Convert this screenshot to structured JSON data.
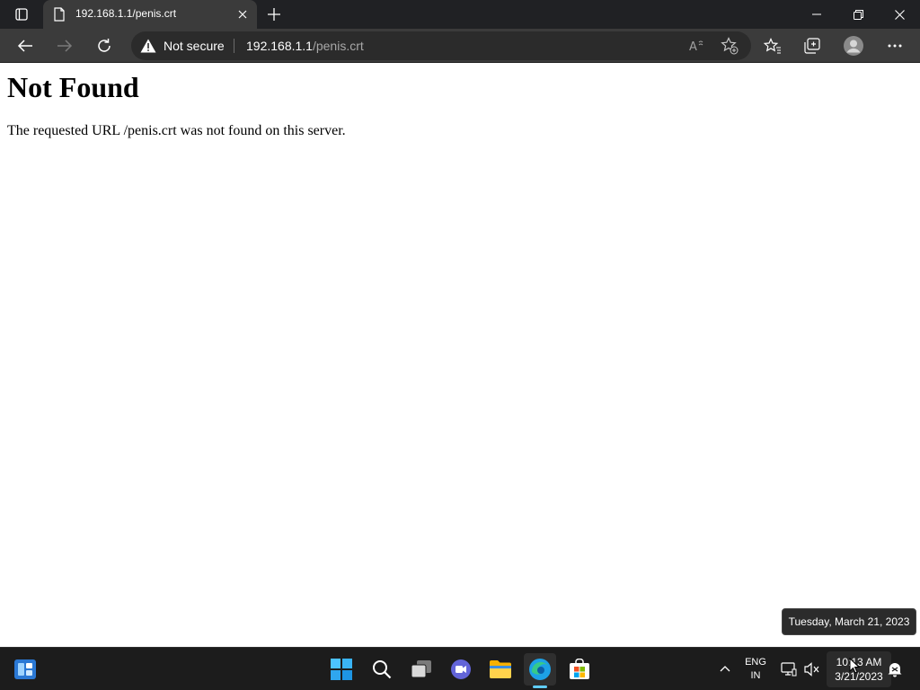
{
  "browser": {
    "tab": {
      "title": "192.168.1.1/penis.crt"
    },
    "address_bar": {
      "security_label": "Not secure",
      "url_host": "192.168.1.1",
      "url_path": "/penis.crt"
    },
    "icons": {
      "tab_actions": "tab-actions-icon",
      "favicon": "page-icon",
      "tab_close": "close-icon",
      "new_tab": "plus-icon",
      "minimize": "minimize-icon",
      "restore": "restore-icon",
      "close_window": "close-icon",
      "back": "arrow-left-icon",
      "forward": "arrow-right-icon",
      "refresh": "refresh-icon",
      "warning": "warning-icon",
      "read_aloud": "read-aloud-icon",
      "add_favorite": "star-plus-icon",
      "favorites": "favorites-icon",
      "collections": "collections-icon",
      "profile": "profile-icon",
      "more": "ellipsis-icon"
    }
  },
  "page": {
    "heading": "Not Found",
    "message": "The requested URL /penis.crt was not found on this server."
  },
  "tooltip": {
    "text": "Tuesday, March 21, 2023"
  },
  "taskbar": {
    "apps": [
      "widgets",
      "start",
      "search",
      "task-view",
      "teams-chat",
      "file-explorer",
      "edge",
      "microsoft-store"
    ],
    "language": {
      "line1": "ENG",
      "line2": "IN"
    },
    "clock": {
      "time": "10:13 AM",
      "date": "3/21/2023"
    }
  },
  "colors": {
    "titlebar_bg": "#202124",
    "toolbar_bg": "#3b3b3b",
    "taskbar_bg": "#1c1c1c",
    "accent": "#60cdff"
  }
}
